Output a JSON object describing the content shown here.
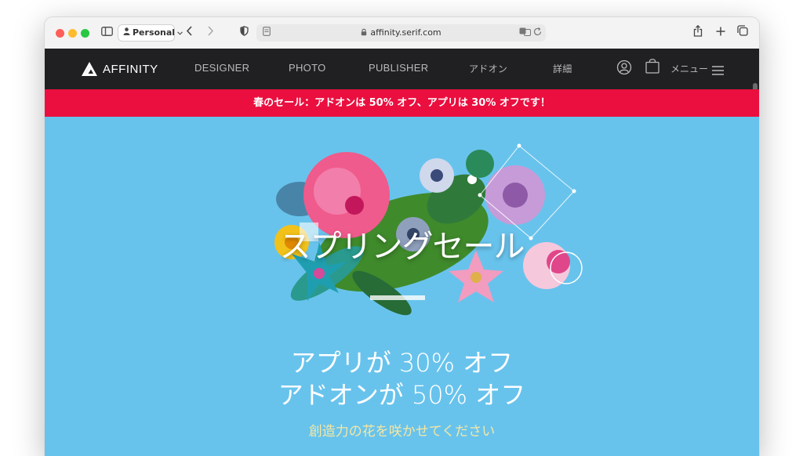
{
  "browser": {
    "profile_label": "Personal",
    "url": "affinity.serif.com"
  },
  "site_nav": {
    "brand": "AFFINITY",
    "links": [
      "DESIGNER",
      "PHOTO",
      "PUBLISHER",
      "アドオン",
      "詳細"
    ],
    "menu_label": "メニュー"
  },
  "banner": {
    "text": "春のセール：アドオンは 50% オフ、アプリは 30% オフです！"
  },
  "hero": {
    "title": "スプリングセール",
    "line1": "アプリが 30% オフ",
    "line2": "アドオンが 50% オフ",
    "tagline": "創造力の花を咲かせてください"
  },
  "colors": {
    "nav_bg": "#202022",
    "banner_bg": "#ea0f3f",
    "hero_bg": "#68c3ec",
    "tagline": "#f4e7a4"
  },
  "icons": [
    "sidebar-icon",
    "chevron-left-icon",
    "chevron-right-icon",
    "shield-icon",
    "reader-icon",
    "lock-icon",
    "translate-icon",
    "reload-icon",
    "share-icon",
    "plus-icon",
    "tabs-icon",
    "account-icon",
    "cart-icon",
    "hamburger-icon"
  ]
}
